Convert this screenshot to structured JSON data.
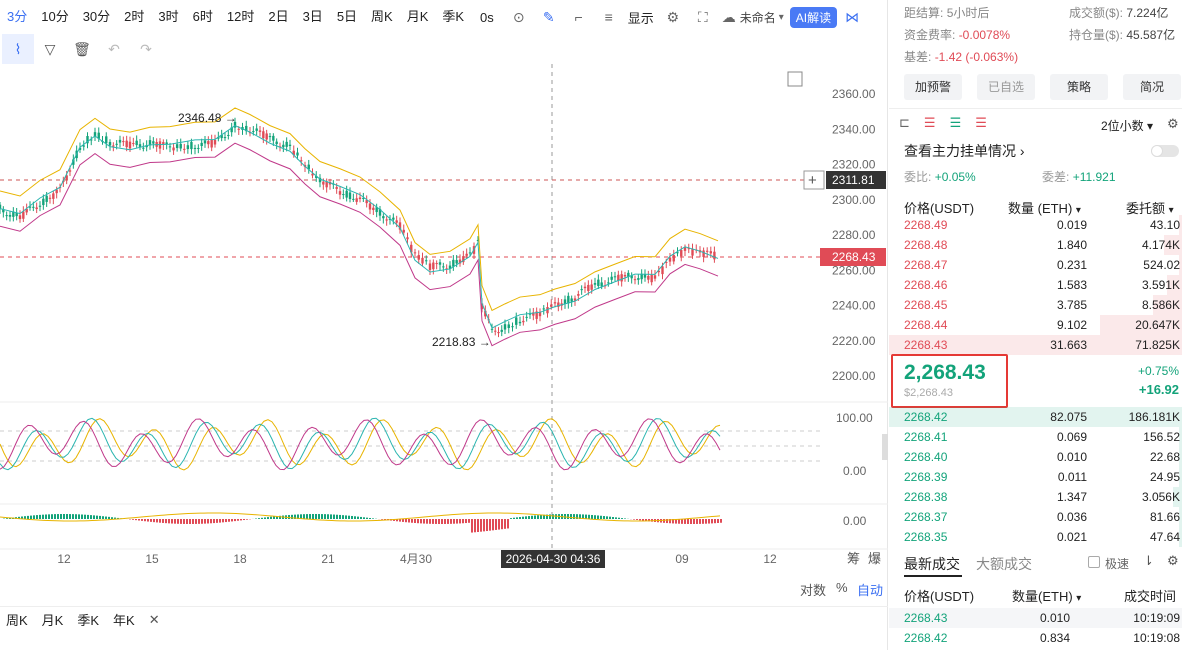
{
  "toolbar": {
    "timeframes": [
      "3分",
      "10分",
      "30分",
      "2时",
      "3时",
      "6时",
      "12时",
      "2日",
      "3日",
      "5日",
      "周K",
      "月K",
      "季K"
    ],
    "active_timeframe": "3分",
    "countdown": "0s",
    "display_label": "显示",
    "layout_name": "未命名",
    "ai_label": "AI解读"
  },
  "chart": {
    "price_axis": [
      "2360.00",
      "2340.00",
      "2320.00",
      "2300.00",
      "2280.00",
      "2260.00",
      "2240.00",
      "2220.00",
      "2200.00"
    ],
    "osc_axis": [
      "100.00",
      "0.00"
    ],
    "macd_axis": [
      "0.00"
    ],
    "time_axis": [
      "12",
      "15",
      "18",
      "21",
      "4月30",
      "09",
      "12"
    ],
    "crosshair_price": "2311.81",
    "last_price_tag": "2268.43",
    "crosshair_time": "2026-04-30 04:36",
    "high_label": "2346.48 →",
    "low_label": "2218.83 →",
    "corner_labels": [
      "筹",
      "爆"
    ],
    "bottom_right": [
      "对数",
      "%",
      "自动"
    ]
  },
  "period_bar": [
    "周K",
    "月K",
    "季K",
    "年K"
  ],
  "colors": {
    "up": "#13a37a",
    "down": "#e04b56",
    "accent": "#3a6ff2"
  },
  "info": {
    "settle_label": "距结算:",
    "settle_value": "5小时后",
    "volume_label": "成交额($):",
    "volume_value": "7.224亿",
    "funding_label": "资金费率:",
    "funding_value": "-0.0078%",
    "oi_label": "持仓量($):",
    "oi_value": "45.587亿",
    "basis_label": "基差:",
    "basis_value": "-1.42 (-0.063%)"
  },
  "buttons": [
    "加预警",
    "已自选",
    "策略",
    "简况"
  ],
  "orderbook": {
    "precision": "2位小数",
    "main_orders": "查看主力挂单情况",
    "ratio_label": "委比:",
    "ratio_value": "+0.05%",
    "diff_label": "委差:",
    "diff_value": "+11.921",
    "col_price": "价格(USDT)",
    "col_qty": "数量 (ETH)",
    "col_total": "委托额",
    "asks": [
      {
        "p": "2268.49",
        "q": "0.019",
        "t": "43.10",
        "w": 0.01
      },
      {
        "p": "2268.48",
        "q": "1.840",
        "t": "4.174K",
        "w": 0.06
      },
      {
        "p": "2268.47",
        "q": "0.231",
        "t": "524.02",
        "w": 0.01
      },
      {
        "p": "2268.46",
        "q": "1.583",
        "t": "3.591K",
        "w": 0.05
      },
      {
        "p": "2268.45",
        "q": "3.785",
        "t": "8.586K",
        "w": 0.1
      },
      {
        "p": "2268.44",
        "q": "9.102",
        "t": "20.647K",
        "w": 0.28
      },
      {
        "p": "2268.43",
        "q": "31.663",
        "t": "71.825K",
        "w": 1.0
      }
    ],
    "last_price": "2,268.43",
    "last_price_usd": "$2,268.43",
    "change_pct": "+0.75%",
    "change_abs": "+16.92",
    "bids": [
      {
        "p": "2268.42",
        "q": "82.075",
        "t": "186.181K",
        "w": 1.0
      },
      {
        "p": "2268.41",
        "q": "0.069",
        "t": "156.52",
        "w": 0.01
      },
      {
        "p": "2268.40",
        "q": "0.010",
        "t": "22.68",
        "w": 0.01
      },
      {
        "p": "2268.39",
        "q": "0.011",
        "t": "24.95",
        "w": 0.01
      },
      {
        "p": "2268.38",
        "q": "1.347",
        "t": "3.056K",
        "w": 0.03
      },
      {
        "p": "2268.37",
        "q": "0.036",
        "t": "81.66",
        "w": 0.01
      },
      {
        "p": "2268.35",
        "q": "0.021",
        "t": "47.64",
        "w": 0.01
      }
    ]
  },
  "trades": {
    "tab_latest": "最新成交",
    "tab_large": "大额成交",
    "fast_label": "极速",
    "col_price": "价格(USDT)",
    "col_qty": "数量(ETH)",
    "col_time": "成交时间",
    "rows": [
      {
        "p": "2268.43",
        "q": "0.010",
        "t": "10:19:09"
      },
      {
        "p": "2268.42",
        "q": "0.834",
        "t": "10:19:08"
      }
    ]
  }
}
